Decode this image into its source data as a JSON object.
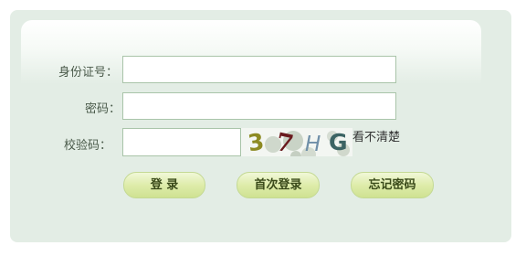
{
  "form": {
    "id_label": "身份证号：",
    "password_label": "密码：",
    "captcha_label": "校验码：",
    "id_value": "",
    "password_value": "",
    "captcha_value": "",
    "captcha_text": "37HG",
    "cant_see_label": "看不清楚"
  },
  "buttons": {
    "login": "登 录",
    "first_login": "首次登录",
    "forgot_password": "忘记密码"
  },
  "colors": {
    "panel": "#e3ede5",
    "button": "#deecaa",
    "label": "#4a5a4a"
  }
}
